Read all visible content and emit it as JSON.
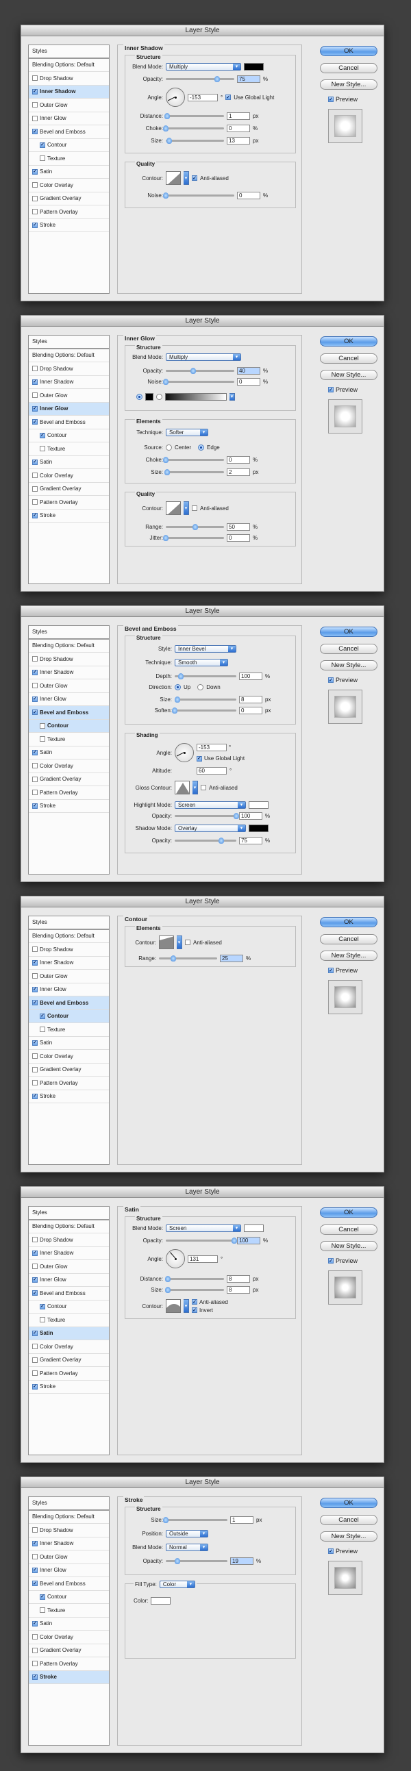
{
  "title": "Layer Style",
  "buttons": {
    "ok": "OK",
    "cancel": "Cancel",
    "new_style": "New Style...",
    "preview": "Preview"
  },
  "sidebar": [
    "Styles",
    "Blending Options: Default",
    "Drop Shadow",
    "Inner Shadow",
    "Outer Glow",
    "Inner Glow",
    "Bevel and Emboss",
    "Contour",
    "Texture",
    "Satin",
    "Color Overlay",
    "Gradient Overlay",
    "Pattern Overlay",
    "Stroke"
  ],
  "common": {
    "structure": "Structure",
    "quality": "Quality",
    "elements": "Elements",
    "shading": "Shading",
    "blend_mode": "Blend Mode:",
    "opacity": "Opacity:",
    "noise": "Noise:",
    "angle": "Angle:",
    "distance": "Distance:",
    "choke": "Choke:",
    "size": "Size:",
    "contour": "Contour:",
    "anti_aliased": "Anti-aliased",
    "use_global_light": "Use Global Light",
    "percent": "%",
    "px": "px",
    "deg": "°"
  },
  "inner_shadow": {
    "heading": "Inner Shadow",
    "blend_mode": "Multiply",
    "opacity": "75",
    "angle": "-153",
    "distance": "1",
    "choke": "0",
    "size": "13",
    "noise": "0",
    "color": "#000000"
  },
  "inner_glow": {
    "heading": "Inner Glow",
    "blend_mode": "Multiply",
    "opacity": "40",
    "noise": "0",
    "technique_label": "Technique:",
    "technique": "Softer",
    "source_label": "Source:",
    "center": "Center",
    "edge": "Edge",
    "choke": "0",
    "size": "2",
    "range_label": "Range:",
    "range": "50",
    "jitter_label": "Jitter:",
    "jitter": "0"
  },
  "bevel": {
    "heading": "Bevel and Emboss",
    "style_label": "Style:",
    "style": "Inner Bevel",
    "technique_label": "Technique:",
    "technique": "Smooth",
    "depth_label": "Depth:",
    "depth": "100",
    "direction_label": "Direction:",
    "up": "Up",
    "down": "Down",
    "size": "8",
    "soften_label": "Soften:",
    "soften": "0",
    "angle": "-153",
    "altitude_label": "Altitude:",
    "altitude": "60",
    "gloss_label": "Gloss Contour:",
    "highlight_label": "Highlight Mode:",
    "highlight_mode": "Screen",
    "highlight_opacity": "100",
    "shadow_label": "Shadow Mode:",
    "shadow_mode": "Overlay",
    "shadow_opacity": "75",
    "highlight_color": "#ffffff",
    "shadow_color": "#000000"
  },
  "contour": {
    "heading": "Contour",
    "range_label": "Range:",
    "range": "25"
  },
  "satin": {
    "heading": "Satin",
    "blend_mode": "Screen",
    "opacity": "100",
    "angle": "131",
    "distance": "8",
    "size": "8",
    "invert": "Invert",
    "color": "#ffffff"
  },
  "stroke": {
    "heading": "Stroke",
    "size": "1",
    "position_label": "Position:",
    "position": "Outside",
    "blend_mode": "Normal",
    "opacity": "19",
    "fill_label": "Fill Type:",
    "fill_type": "Color",
    "color_label": "Color:",
    "color": "#ffffff"
  }
}
